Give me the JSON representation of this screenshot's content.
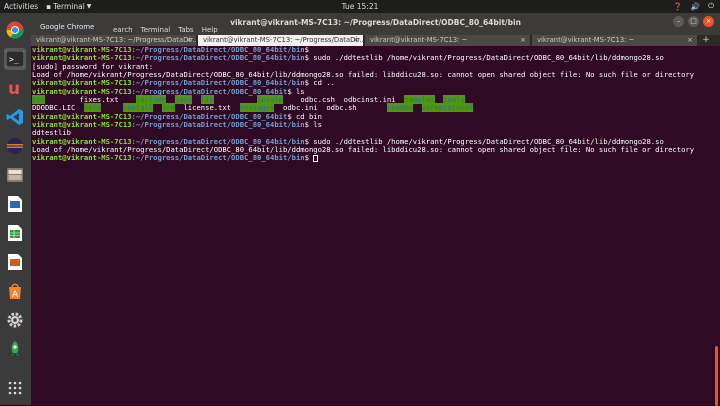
{
  "topbar": {
    "activities": "Activities",
    "app_name": "Terminal",
    "clock": "Tue 15:21",
    "status_icons": [
      "help-icon",
      "volume-icon",
      "power-icon"
    ]
  },
  "dock": {
    "tooltip": "Google Chrome",
    "items": [
      "chrome",
      "terminal",
      "udemy",
      "vscode",
      "eclipse",
      "files",
      "writer",
      "calc",
      "impress",
      "software",
      "settings",
      "rocket",
      "apps"
    ]
  },
  "window": {
    "title": "vikrant@vikrant-MS-7C13: ~/Progress/DataDirect/ODBC_80_64bit/bin",
    "menu": [
      "Search",
      "Terminal",
      "Tabs",
      "Help"
    ],
    "menu_partial_first": "earch",
    "tabs": [
      {
        "label": "vikrant@vikrant-MS-7C13: ~/Progress/DataDir...",
        "active": false
      },
      {
        "label": "vikrant@vikrant-MS-7C13: ~/Progress/DataDir...",
        "active": true
      },
      {
        "label": "vikrant@vikrant-MS-7C13: ~",
        "active": false
      },
      {
        "label": "vikrant@vikrant-MS-7C13: ~",
        "active": false
      }
    ]
  },
  "terminal": {
    "prompt_user": "vikrant@vikrant-MS-7C13",
    "lines": [
      {
        "path": ":~/Progress/DataDirect/ODBC_80_64bit/bin",
        "cmd": "$ "
      },
      {
        "path": ":~/Progress/DataDirect/ODBC_80_64bit/bin",
        "cmd": "$ sudo ./ddtestlib /home/vikrant/Progress/DataDirect/ODBC_80_64bit/lib/ddmongo28.so"
      },
      {
        "out": "[sudo] password for vikrant:"
      },
      {
        "out": "Load of /home/vikrant/Progress/DataDirect/ODBC_80_64bit/lib/ddmongo28.so failed: libddicu28.so: cannot open shared object file: No such file or directory"
      },
      {
        "path": ":~/Progress/DataDirect/ODBC_80_64bit/bin",
        "cmd": "$ cd .."
      },
      {
        "path": ":~/Progress/DataDirect/ODBC_80_64bit",
        "cmd": "$ ls"
      },
      {
        "ls1": [
          "bin",
          "fixes.txt",
          "include",
          "java",
          "lib",
          "locale",
          "odbc.csh",
          "odbcinst.ini",
          "samples",
          "tools"
        ]
      },
      {
        "ls2": [
          "DDODBC.LIC",
          "help",
          "install",
          "jre",
          "license.txt",
          "messages",
          "odbc.ini",
          "odbc.sh",
          "readme",
          "wireprotocol"
        ]
      },
      {
        "path": ":~/Progress/DataDirect/ODBC_80_64bit",
        "cmd": "$ cd bin"
      },
      {
        "path": ":~/Progress/DataDirect/ODBC_80_64bit/bin",
        "cmd": "$ ls"
      },
      {
        "out": "ddtestlib"
      },
      {
        "path": ":~/Progress/DataDirect/ODBC_80_64bit/bin",
        "cmd": "$ sudo ./ddtestlib /home/vikrant/Progress/DataDirect/ODBC_80_64bit/lib/ddmongo28.so"
      },
      {
        "out": "Load of /home/vikrant/Progress/DataDirect/ODBC_80_64bit/lib/ddmongo28.so failed: libddicu28.so: cannot open shared object file: No such file or directory"
      },
      {
        "path": ":~/Progress/DataDirect/ODBC_80_64bit/bin",
        "cmd": "$ "
      }
    ]
  },
  "colors": {
    "terminal_bg": "#300a24",
    "prompt_user": "#8ae234",
    "prompt_path": "#729fcf",
    "accent": "#e95420"
  }
}
